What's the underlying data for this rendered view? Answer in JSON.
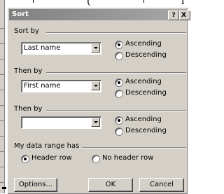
{
  "background": {
    "title_fragment": "( ",
    "title_fragment_right": "l"
  },
  "dialog": {
    "title": "Sort",
    "help_button_label": "?",
    "close_button_label": "X",
    "sort_by": {
      "label": "Sort by",
      "value": "Last name",
      "ascending_label": "Ascending",
      "descending_label": "Descending",
      "selected": "ascending"
    },
    "then_by_1": {
      "label": "Then by",
      "value": "First name",
      "ascending_label": "Ascending",
      "descending_label": "Descending",
      "selected": "ascending"
    },
    "then_by_2": {
      "label": "Then by",
      "value": "",
      "ascending_label": "Ascending",
      "descending_label": "Descending",
      "selected": "ascending"
    },
    "header": {
      "label": "My data range has",
      "header_row_label": "Header row",
      "no_header_row_label": "No header row",
      "selected": "header_row"
    },
    "buttons": {
      "options": "Options...",
      "ok": "OK",
      "cancel": "Cancel"
    },
    "colors": {
      "face": "#d4d0c8",
      "title_bar": "#808080"
    }
  }
}
